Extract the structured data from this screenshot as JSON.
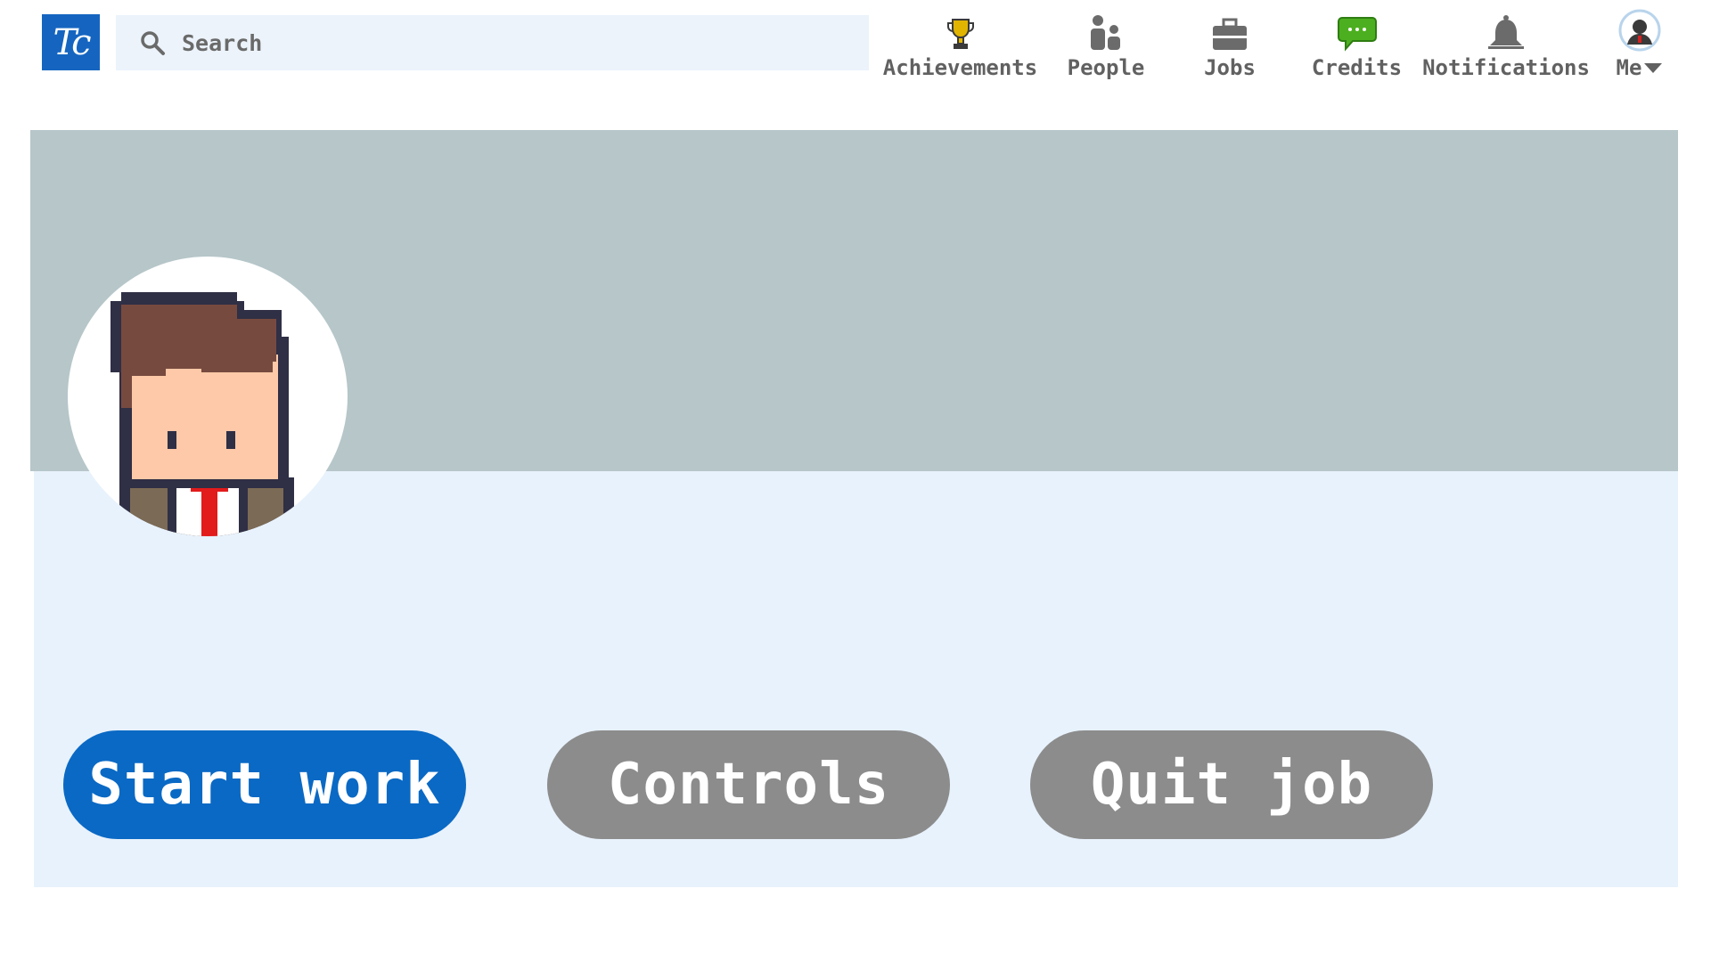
{
  "logo": {
    "text": "Tc"
  },
  "search": {
    "placeholder": "Search"
  },
  "nav": {
    "achievements": "Achievements",
    "people": "People",
    "jobs": "Jobs",
    "credits": "Credits",
    "notifications": "Notifications",
    "me": "Me"
  },
  "icons": {
    "search": "search-icon",
    "achievements": "trophy-icon",
    "people": "people-icon",
    "jobs": "briefcase-icon",
    "credits": "chat-bubble-icon",
    "notifications": "bell-icon",
    "me": "user-avatar-icon"
  },
  "buttons": {
    "start": "Start work",
    "controls": "Controls",
    "quit": "Quit job"
  },
  "colors": {
    "brand": "#1565c0",
    "primary_button": "#0a69c4",
    "secondary_button": "#8c8c8c",
    "cover": "#b6c6c9",
    "content_bg": "#e8f2fc"
  }
}
